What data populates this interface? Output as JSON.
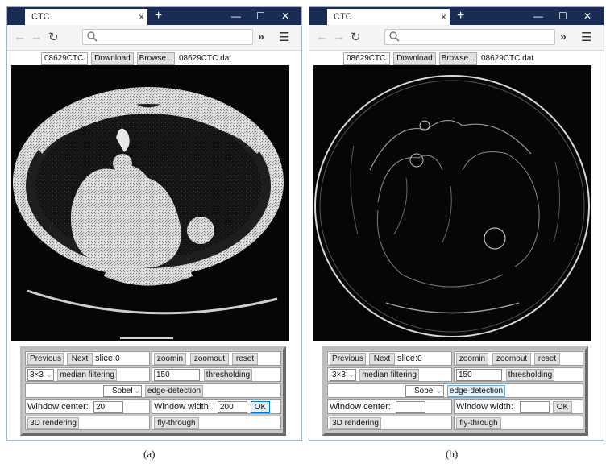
{
  "browser": {
    "tab_title": "CTC",
    "tab_close": "×",
    "new_tab": "+",
    "minimize": "—",
    "maximize": "☐",
    "close": "✕",
    "back": "←",
    "forward": "→",
    "reload": "↻",
    "more": "»",
    "menu": "☰"
  },
  "icons": [
    "search-icon",
    "back-arrow-icon",
    "forward-arrow-icon",
    "reload-icon",
    "overflow-chevron-icon",
    "hamburger-menu-icon",
    "dropdown-arrow-icon"
  ],
  "colors": {
    "titlebar": "#1a2c55",
    "image_bg": "#060606",
    "panel": "#c8c8c8",
    "ok_border": "#0078d7"
  },
  "windows": [
    {
      "dataset_select": "08629CTC",
      "download_label": "Download",
      "browse_label": "Browse...",
      "file_name": "08629CTC.dat",
      "image_mode": "ct-slice",
      "panel": {
        "previous": "Previous",
        "next": "Next",
        "slice_label": "slice:",
        "slice_value": "0",
        "zoomin": "zoomin",
        "zoomout": "zoomout",
        "reset": "reset",
        "kernel": "3×3",
        "median": "median filtering",
        "threshold_value": "150",
        "thresholding": "thresholding",
        "edge_operator": "Sobel",
        "edge_detection": "edge-detection",
        "window_center_label": "Window center:",
        "window_center_value": "20",
        "window_width_label": "Window width:",
        "window_width_value": "200",
        "ok": "OK",
        "render3d": "3D rendering",
        "flythrough": "fly-through"
      },
      "caption": "(a)"
    },
    {
      "dataset_select": "08629CTC",
      "download_label": "Download",
      "browse_label": "Browse...",
      "file_name": "08629CTC.dat",
      "image_mode": "edge-map",
      "panel": {
        "previous": "Previous",
        "next": "Next",
        "slice_label": "slice:",
        "slice_value": "0",
        "zoomin": "zoomin",
        "zoomout": "zoomout",
        "reset": "reset",
        "kernel": "3×3",
        "median": "median filtering",
        "threshold_value": "150",
        "thresholding": "thresholding",
        "edge_operator": "Sobel",
        "edge_detection": "edge-detection",
        "window_center_label": "Window center:",
        "window_center_value": "",
        "window_width_label": "Window width:",
        "window_width_value": "",
        "ok": "OK",
        "render3d": "3D rendering",
        "flythrough": "fly-through"
      },
      "caption": "(b)"
    }
  ]
}
